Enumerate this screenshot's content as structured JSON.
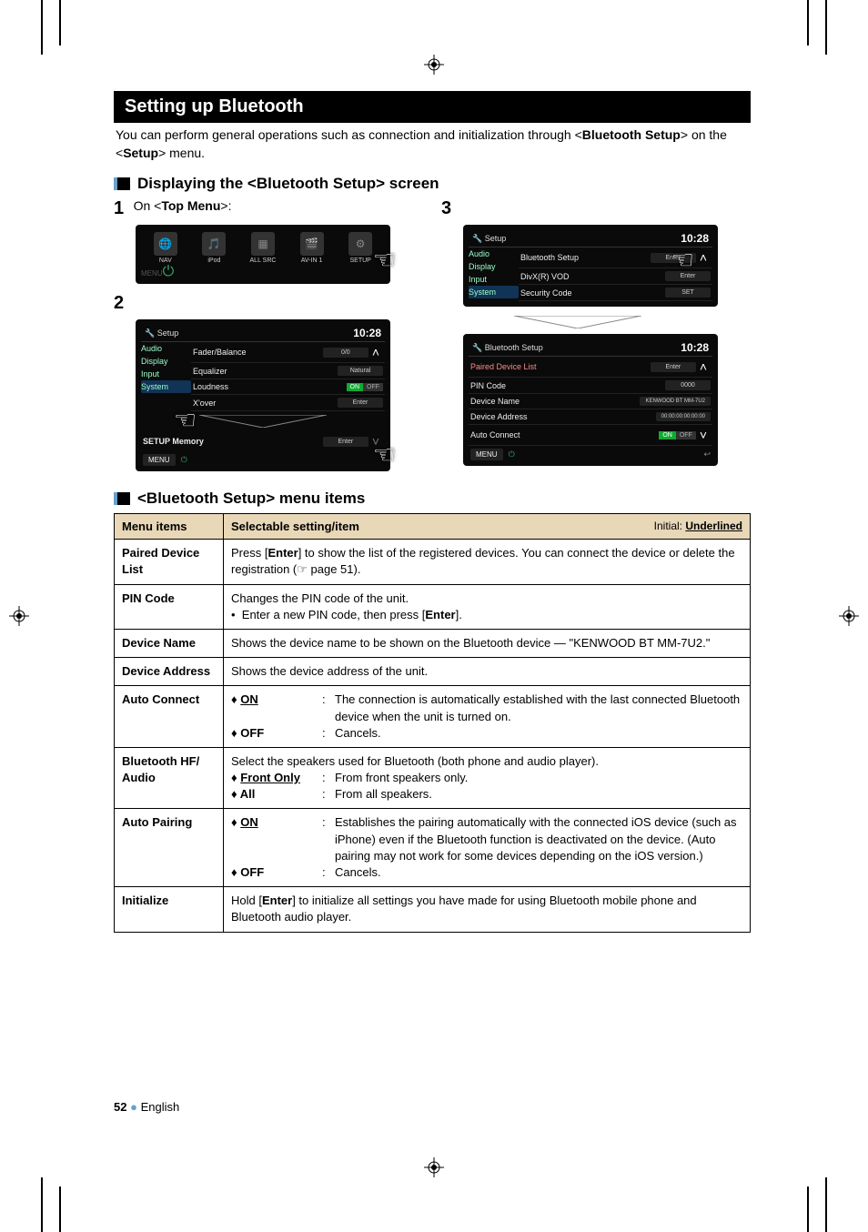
{
  "header": {
    "section_title": "Setting up Bluetooth",
    "intro_prefix": "You can perform general operations such as connection and initialization through <",
    "intro_bold1": "Bluetooth Setup",
    "intro_mid": "> on the <",
    "intro_bold2": "Setup",
    "intro_suffix": "> menu."
  },
  "sub1": "Displaying the <Bluetooth Setup> screen",
  "steps": {
    "s1_num": "1",
    "s1_prefix": "On <",
    "s1_bold": "Top Menu",
    "s1_suffix": ">:",
    "s2_num": "2",
    "s3_num": "3"
  },
  "topmenu": {
    "icons": [
      "NAV",
      "iPod",
      "",
      "AV-IN 1",
      "SETUP"
    ],
    "all_src": "ALL SRC"
  },
  "setup2": {
    "title": "Setup",
    "clock": "10:28",
    "side": [
      "Audio",
      "Display",
      "Input",
      "System"
    ],
    "rows": [
      {
        "label": "Fader/Balance",
        "val": "0/0"
      },
      {
        "label": "Equalizer",
        "val": "Natural"
      },
      {
        "label": "Loudness",
        "on": "ON",
        "off": "OFF"
      },
      {
        "label": "X'over",
        "val": "Enter"
      }
    ],
    "memory": "SETUP Memory",
    "memory_val": "Enter",
    "menu": "MENU"
  },
  "setup3a": {
    "title": "Setup",
    "clock": "10:28",
    "side": [
      "Audio",
      "Display",
      "Input",
      "System"
    ],
    "rows": [
      {
        "label": "Bluetooth Setup",
        "val": "Enter"
      },
      {
        "label": "DivX(R) VOD",
        "val": "Enter"
      },
      {
        "label": "Security Code",
        "val": "SET"
      }
    ]
  },
  "setup3b": {
    "title": "Bluetooth Setup",
    "clock": "10:28",
    "rows": [
      {
        "label": "Paired Device List",
        "val": "Enter"
      },
      {
        "label": "PIN Code",
        "val": "0000"
      },
      {
        "label": "Device Name",
        "val": "KENWOOD BT MM-7U2"
      },
      {
        "label": "Device Address",
        "val": "00:00:00:00:00:00"
      },
      {
        "label": "Auto Connect",
        "on": "ON",
        "off": "OFF"
      }
    ],
    "menu": "MENU"
  },
  "sub2": "<Bluetooth Setup> menu items",
  "table": {
    "head_menu": "Menu items",
    "head_sel": "Selectable setting/item",
    "head_initial_prefix": "Initial: ",
    "head_initial_bold": "Underlined",
    "rows": {
      "paired": {
        "name": "Paired Device List",
        "p1": "Press [",
        "b1": "Enter",
        "p2": "] to show the list of the registered devices. You can connect the device or delete the registration (☞ page 51)."
      },
      "pin": {
        "name": "PIN Code",
        "line1": "Changes the PIN code of the unit.",
        "bullet_pre": "Enter a new PIN code, then press [",
        "bullet_b": "Enter",
        "bullet_post": "]."
      },
      "devname": {
        "name": "Device Name",
        "text": "Shows the device name to be shown on the Bluetooth device — \"KENWOOD BT MM-7U2.\""
      },
      "devaddr": {
        "name": "Device Address",
        "text": "Shows the device address of the unit."
      },
      "autocon": {
        "name": "Auto Connect",
        "on_label": "ON",
        "on_desc": "The connection is automatically established with the last connected Bluetooth device when the unit is turned on.",
        "off_label": "OFF",
        "off_desc": "Cancels."
      },
      "bthf": {
        "name": "Bluetooth HF/ Audio",
        "intro": "Select the speakers used for Bluetooth (both phone and audio player).",
        "fo_label": "Front Only",
        "fo_desc": "From front speakers only.",
        "all_label": "All",
        "all_desc": "From all speakers."
      },
      "autopair": {
        "name": "Auto Pairing",
        "on_label": "ON",
        "on_desc": "Establishes the pairing automatically with the connected iOS device (such as iPhone) even if the Bluetooth function is deactivated on the device. (Auto pairing may not work for some devices depending on the iOS version.)",
        "off_label": "OFF",
        "off_desc": "Cancels."
      },
      "init": {
        "name": "Initialize",
        "p1": "Hold [",
        "b1": "Enter",
        "p2": "] to initialize all settings you have made for using Bluetooth mobile phone and Bluetooth audio player."
      }
    }
  },
  "footer": {
    "page": "52",
    "lang": "English"
  }
}
